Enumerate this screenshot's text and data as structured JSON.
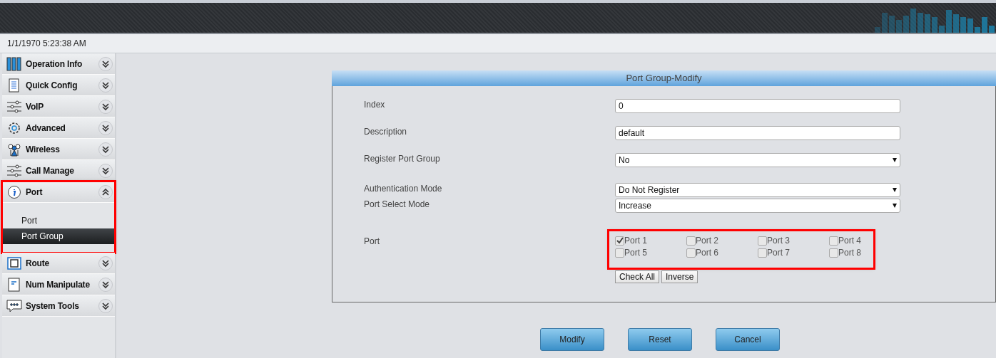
{
  "status_bar": {
    "datetime": "1/1/1970 5:23:38 AM"
  },
  "sidebar": {
    "items": [
      {
        "label": "Operation Info",
        "expanded": false,
        "highlighted": false
      },
      {
        "label": "Quick Config",
        "expanded": false,
        "highlighted": false
      },
      {
        "label": "VoIP",
        "expanded": false,
        "highlighted": false
      },
      {
        "label": "Advanced",
        "expanded": false,
        "highlighted": false
      },
      {
        "label": "Wireless",
        "expanded": false,
        "highlighted": false
      },
      {
        "label": "Call Manage",
        "expanded": false,
        "highlighted": false
      },
      {
        "label": "Port",
        "expanded": true,
        "highlighted": true,
        "children": [
          {
            "label": "Port",
            "selected": false
          },
          {
            "label": "Port Group",
            "selected": true
          }
        ]
      },
      {
        "label": "Route",
        "expanded": false,
        "highlighted": false
      },
      {
        "label": "Num Manipulate",
        "expanded": false,
        "highlighted": false
      },
      {
        "label": "System Tools",
        "expanded": false,
        "highlighted": false
      }
    ]
  },
  "panel": {
    "title": "Port Group-Modify",
    "fields": [
      {
        "kind": "text",
        "label": "Index",
        "value": "0"
      },
      {
        "kind": "text",
        "label": "Description",
        "value": "default"
      },
      {
        "kind": "select",
        "label": "Register Port Group",
        "value": "No"
      },
      {
        "kind": "select",
        "label": "Authentication Mode",
        "value": "Do Not Register"
      },
      {
        "kind": "select",
        "label": "Port Select Mode",
        "value": "Increase"
      }
    ],
    "ports": {
      "label": "Port",
      "highlighted": true,
      "items": [
        {
          "label": "Port 1",
          "checked": true
        },
        {
          "label": "Port 2",
          "checked": false
        },
        {
          "label": "Port 3",
          "checked": false
        },
        {
          "label": "Port 4",
          "checked": false
        },
        {
          "label": "Port 5",
          "checked": false
        },
        {
          "label": "Port 6",
          "checked": false
        },
        {
          "label": "Port 7",
          "checked": false
        },
        {
          "label": "Port 8",
          "checked": false
        }
      ],
      "buttons": [
        "Check All",
        "Inverse"
      ]
    }
  },
  "buttons": [
    "Modify",
    "Reset",
    "Cancel"
  ]
}
